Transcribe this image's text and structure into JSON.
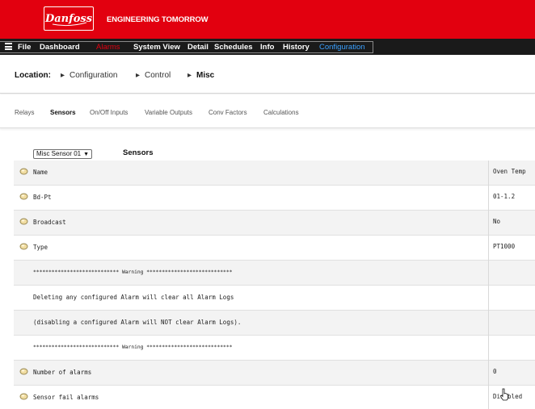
{
  "brand": {
    "logo_text": "Danfoss",
    "tagline": "ENGINEERING TOMORROW",
    "color": "#e2000f"
  },
  "nav": {
    "items": [
      {
        "label": "File",
        "state": "normal"
      },
      {
        "label": "Dashboard",
        "state": "normal"
      },
      {
        "label": "Alarms",
        "state": "alarm"
      },
      {
        "label": "System View",
        "state": "normal"
      },
      {
        "label": "Detail",
        "state": "normal"
      },
      {
        "label": "Schedules",
        "state": "normal"
      },
      {
        "label": "Info",
        "state": "normal"
      },
      {
        "label": "History",
        "state": "normal"
      },
      {
        "label": "Configuration",
        "state": "active"
      }
    ],
    "active_color": "#3aa0ff"
  },
  "breadcrumb": {
    "label": "Location:",
    "items": [
      "Configuration",
      "Control",
      "Misc"
    ],
    "separator": "▸"
  },
  "subtabs": {
    "items": [
      "Relays",
      "Sensors",
      "On/Off Inputs",
      "Variable Outputs",
      "Conv Factors",
      "Calculations"
    ],
    "active": "Sensors"
  },
  "section": {
    "selector_value": "Misc Sensor 01",
    "title": "Sensors"
  },
  "rows": [
    {
      "label": "Name",
      "value": "Oven Temp",
      "icon": "edit-dot-icon"
    },
    {
      "label": "Bd-Pt",
      "value": "01-1.2",
      "icon": "edit-dot-icon"
    },
    {
      "label": "Broadcast",
      "value": "No",
      "icon": "edit-dot-icon"
    },
    {
      "label": "Type",
      "value": "PT1000",
      "icon": "edit-dot-icon"
    },
    {
      "label": "**************************** Warning ****************************",
      "value": "",
      "icon": ""
    },
    {
      "label": "Deleting any configured Alarm will clear all Alarm Logs",
      "value": "",
      "icon": ""
    },
    {
      "label": "(disabling a configured Alarm will NOT clear Alarm Logs).",
      "value": "",
      "icon": ""
    },
    {
      "label": "**************************** Warning ****************************",
      "value": "",
      "icon": ""
    },
    {
      "label": "Number of alarms",
      "value": "0",
      "icon": "edit-dot-icon"
    },
    {
      "label": "Sensor fail alarms",
      "value": "Disabled",
      "icon": "edit-dot-icon"
    }
  ]
}
